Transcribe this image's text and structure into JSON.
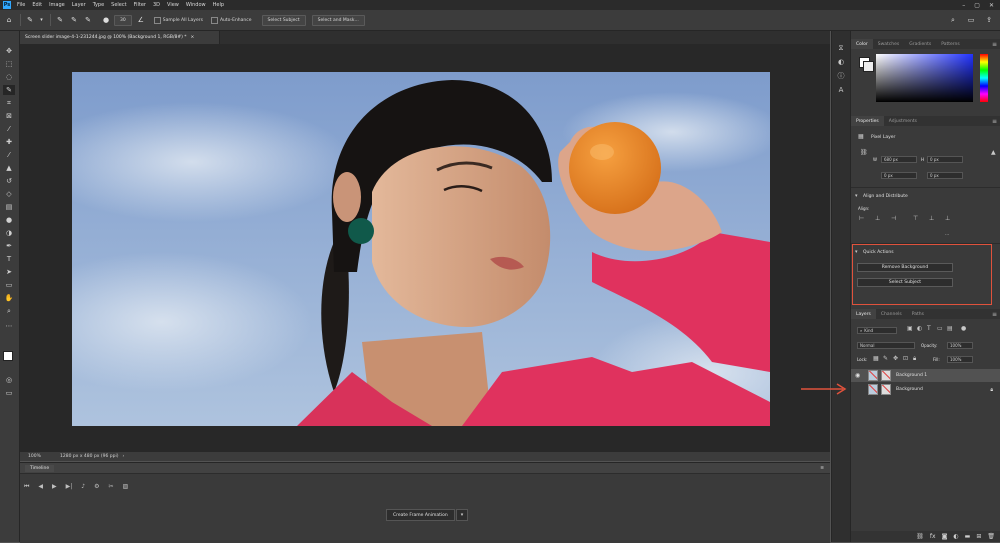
{
  "menubar": {
    "app_badge": "Ps",
    "items": [
      "File",
      "Edit",
      "Image",
      "Layer",
      "Type",
      "Select",
      "Filter",
      "3D",
      "View",
      "Window",
      "Help"
    ]
  },
  "optionsbar": {
    "brush_size": "30",
    "sample_all_layers": "Sample All Layers",
    "auto_enhance": "Auto-Enhance",
    "select_subject": "Select Subject",
    "select_and_mask": "Select and Mask..."
  },
  "document": {
    "tab_title": "Screen slider image-4-1-231244.jpg @ 100% (Background 1, RGB/8#) *",
    "zoom": "100%",
    "dimensions": "1280 px x 480 px (96 ppi)"
  },
  "timeline": {
    "tab": "Timeline",
    "create_button": "Create Frame Animation"
  },
  "color_panel": {
    "tabs": [
      "Color",
      "Swatches",
      "Gradients",
      "Patterns"
    ],
    "active_tab": "Color"
  },
  "properties_panel": {
    "tabs": [
      "Properties",
      "Adjustments"
    ],
    "layer_type": "Pixel Layer",
    "w_label": "W",
    "w_value": "680 px",
    "h_label": "H",
    "h_value": "0 px",
    "x_value": "0 px",
    "y_value": "0 px",
    "align_title": "Align and Distribute",
    "align_label": "Align:",
    "more": "...",
    "quick_actions_title": "Quick Actions",
    "remove_bg": "Remove Background",
    "select_subject": "Select Subject"
  },
  "layers_panel": {
    "tabs": [
      "Layers",
      "Channels",
      "Paths"
    ],
    "kind": "Kind",
    "blend_mode": "Normal",
    "opacity_label": "Opacity:",
    "opacity": "100%",
    "lock_label": "Lock:",
    "fill_label": "Fill:",
    "fill": "100%",
    "layers": [
      {
        "name": "Background 1",
        "selected": true,
        "visible": true
      },
      {
        "name": "Background",
        "selected": false,
        "visible": false
      }
    ]
  },
  "colors": {
    "highlight": "#e0523c",
    "panel": "#3a3a3a",
    "canvas": "#282828"
  }
}
